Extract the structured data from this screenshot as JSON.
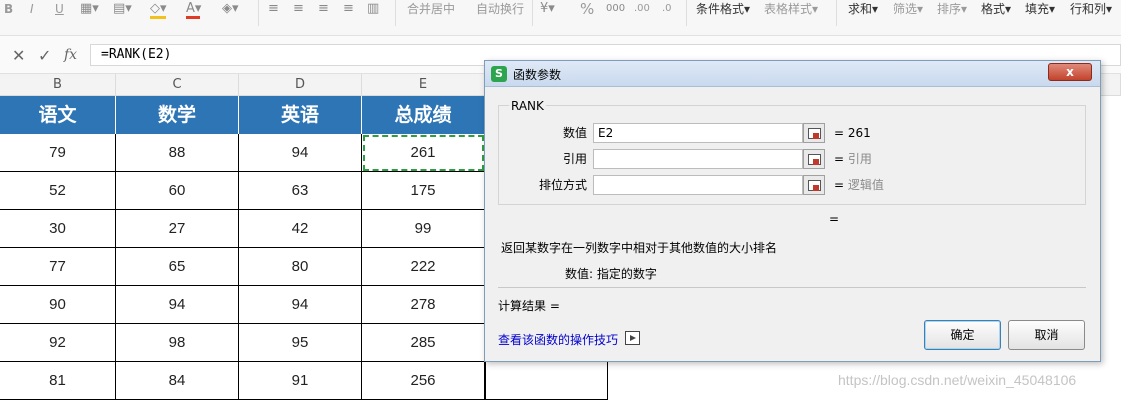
{
  "toolbar": {
    "font_buttons": [
      "B",
      "I",
      "U"
    ],
    "merge_center": "合并居中",
    "wrap_text": "自动换行",
    "percent": "%",
    "decimal_increase": ".00",
    "decimal_decrease": ".0",
    "conditional_format": "条件格式",
    "table_style": "表格样式",
    "sum": "求和",
    "filter": "筛选",
    "sort": "排序",
    "format": "格式",
    "fill": "填充",
    "row_col": "行和列",
    "font_color": "#e03b24",
    "fill_color": "#f2c21b"
  },
  "formula_bar": {
    "cancel_icon": "close-icon",
    "confirm_icon": "check-icon",
    "fx_label": "fx",
    "formula": "=RANK(E2)"
  },
  "sheet": {
    "column_letters": [
      "B",
      "C",
      "D",
      "E"
    ],
    "headers": [
      "语文",
      "数学",
      "英语",
      "总成绩"
    ],
    "rows": [
      [
        "79",
        "88",
        "94",
        "261"
      ],
      [
        "52",
        "60",
        "63",
        "175"
      ],
      [
        "30",
        "27",
        "42",
        "99"
      ],
      [
        "77",
        "65",
        "80",
        "222"
      ],
      [
        "90",
        "94",
        "94",
        "278"
      ],
      [
        "92",
        "98",
        "95",
        "285"
      ],
      [
        "81",
        "84",
        "91",
        "256"
      ]
    ],
    "header_color": "#2e75b6"
  },
  "dialog": {
    "title": "函数参数",
    "close_label": "x",
    "function_name": "RANK",
    "args": [
      {
        "label": "数值",
        "value": "E2",
        "result": "261"
      },
      {
        "label": "引用",
        "value": "",
        "result": "引用"
      },
      {
        "label": "排位方式",
        "value": "",
        "result": "逻辑值"
      }
    ],
    "equals": "=",
    "description": "返回某数字在一列数字中相对于其他数值的大小排名",
    "arg_help": "数值:  指定的数字",
    "calc_result": "计算结果 =",
    "help_link": "查看该函数的操作技巧",
    "ok": "确定",
    "cancel": "取消"
  },
  "watermark": "https://blog.csdn.net/weixin_45048106"
}
